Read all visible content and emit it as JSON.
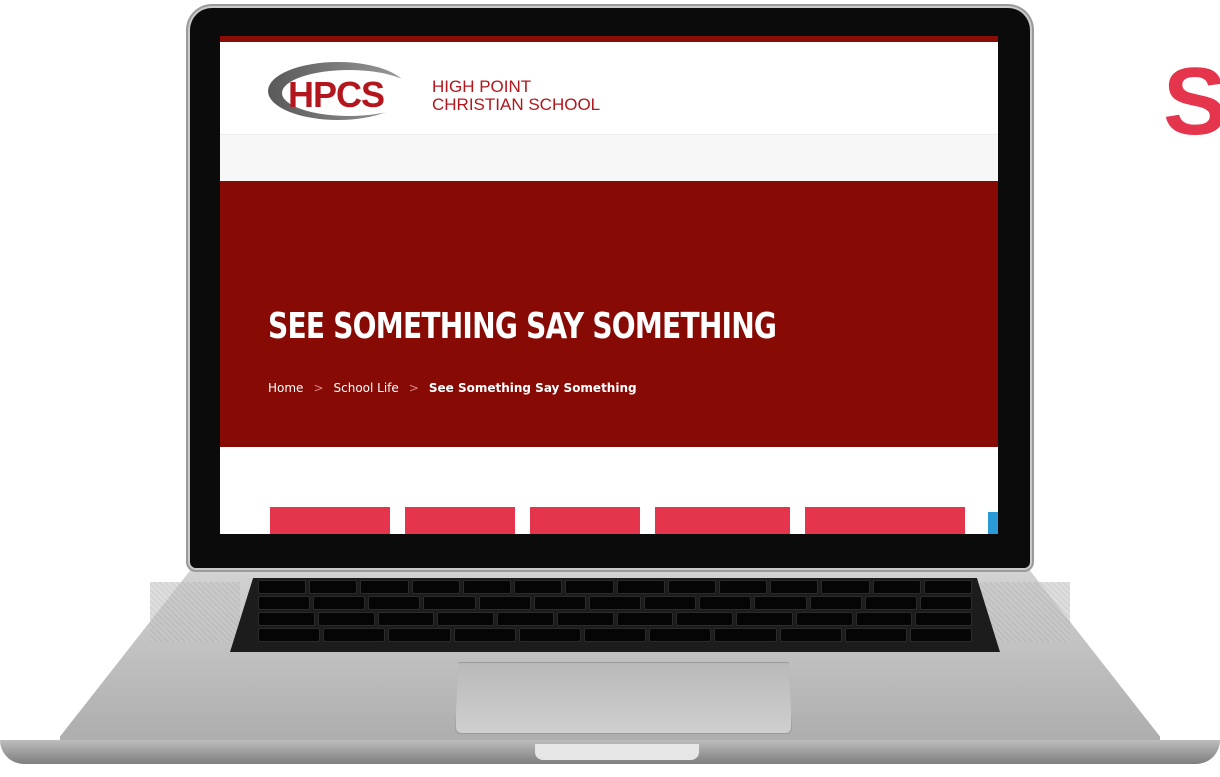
{
  "logo": {
    "text": "HPCS",
    "school_name_line1": "HIGH POINT",
    "school_name_line2": "CHRISTIAN SCHOOL"
  },
  "hero": {
    "title": "SEE SOMETHING SAY SOMETHING",
    "breadcrumbs": [
      {
        "label": "Home"
      },
      {
        "label": "School Life"
      },
      {
        "label": "See Something Say Something"
      }
    ]
  },
  "background_glyph": "S",
  "colors": {
    "brand_red": "#b3161c",
    "hero_red": "#870a05",
    "speak_pink": "#e4354c",
    "accent_blue": "#2b9bd7"
  }
}
